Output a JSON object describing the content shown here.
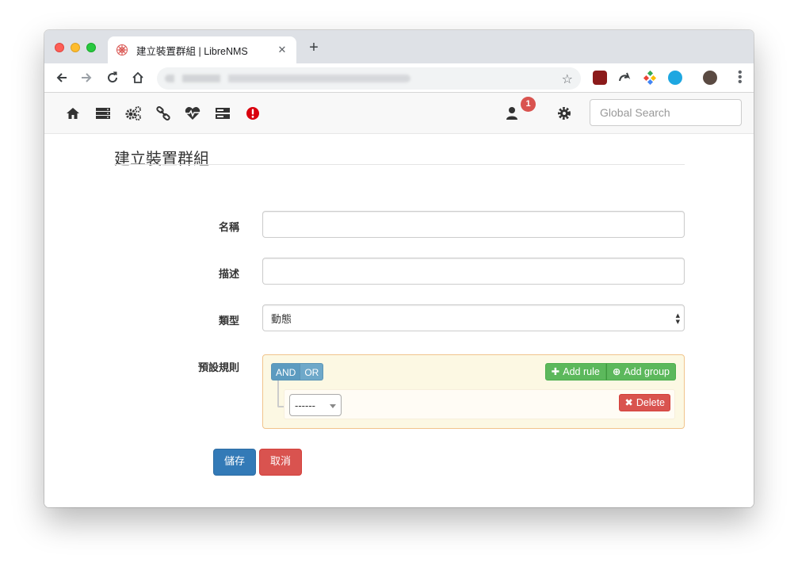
{
  "browser": {
    "tab_title": "建立裝置群組 | LibreNMS",
    "tab_close": "✕",
    "new_tab": "+",
    "bookmark": "☆"
  },
  "navbar": {
    "icons": [
      "home-icon",
      "server-icon",
      "cogs-icon",
      "link-icon",
      "heartbeat-icon",
      "storage-icon",
      "alert-icon",
      "user-icon",
      "gear-icon"
    ],
    "notification_count": "1",
    "search_placeholder": "Global Search"
  },
  "form": {
    "title": "建立裝置群組",
    "name_label": "名稱",
    "name_value": "",
    "description_label": "描述",
    "description_value": "",
    "type_label": "類型",
    "type_value": "動態",
    "rules_label": "預設規則"
  },
  "query_builder": {
    "and_label": "AND",
    "or_label": "OR",
    "add_rule_label": "Add rule",
    "add_group_label": "Add group",
    "field_value": "------",
    "delete_label": "Delete"
  },
  "buttons": {
    "save_label": "儲存",
    "cancel_label": "取消"
  },
  "colors": {
    "primary": "#337ab7",
    "danger": "#d9534f",
    "success": "#5cb85c",
    "info": "#5bc0de"
  }
}
